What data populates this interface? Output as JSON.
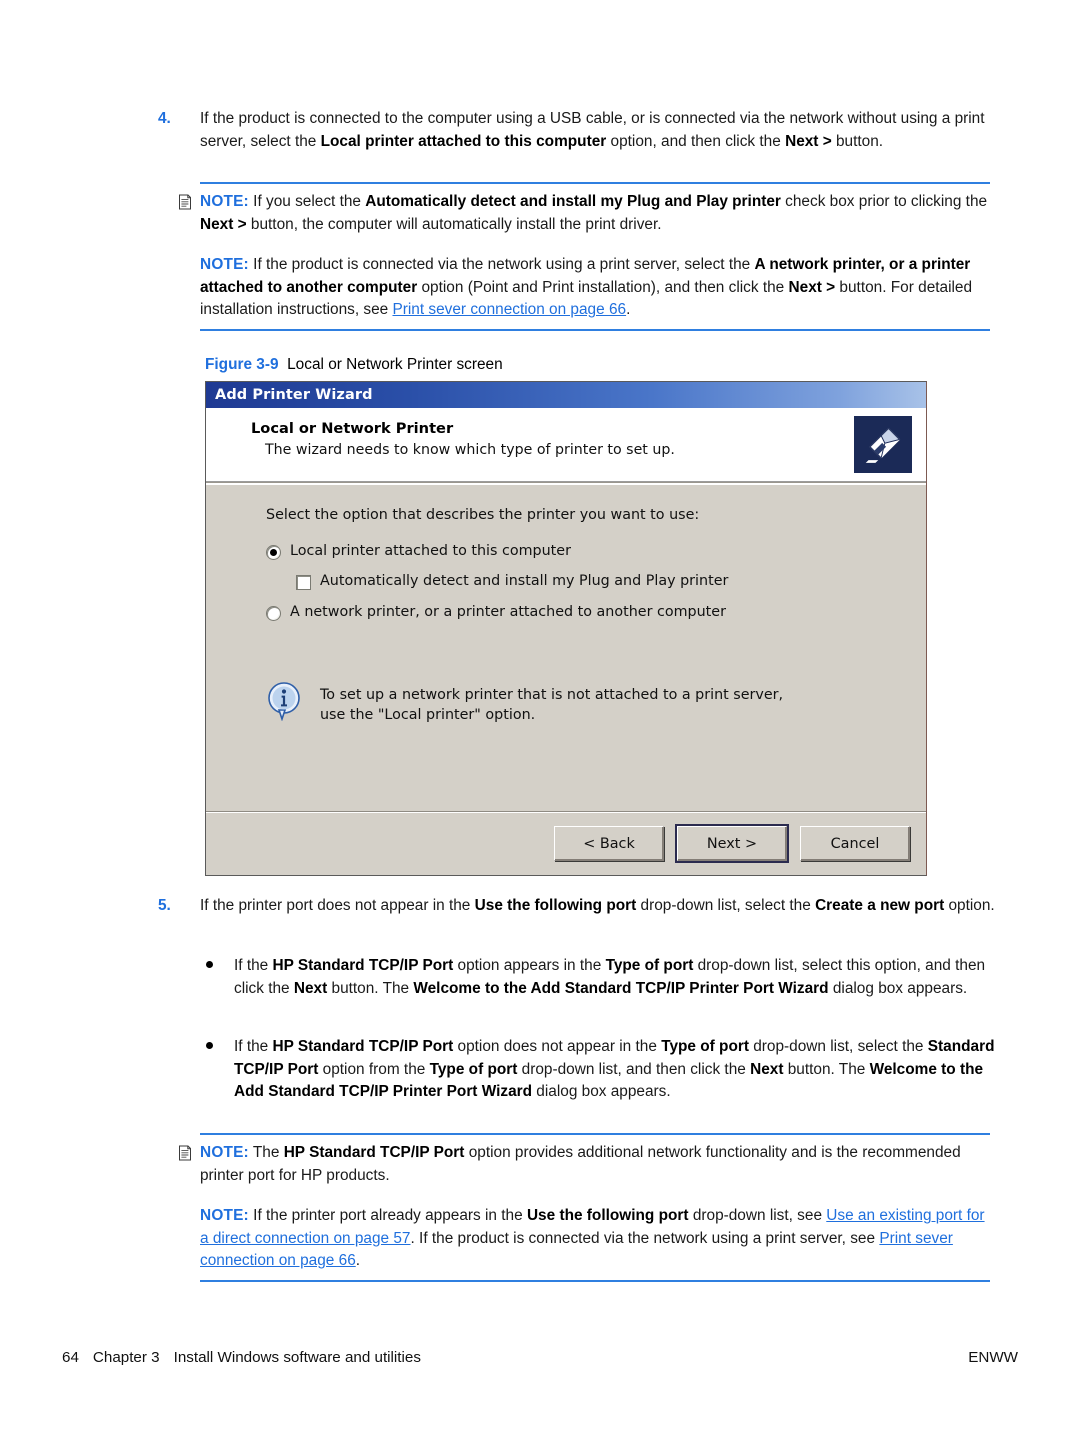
{
  "page": {
    "number": "64",
    "chapter": "Chapter 3",
    "chapter_title": "Install Windows software and utilities",
    "publisher_code": "ENWW"
  },
  "colors": {
    "accent_blue": "#1f6fdd",
    "note_rule": "#2f7fe0",
    "link": "#1f6fdd",
    "dialog_face": "#d4d0c8",
    "titlebar_start": "#1f3a93"
  },
  "step4": {
    "number": "4.",
    "t1": "If the product is connected to the computer using a USB cable, or is connected via the network without using a print server, select the ",
    "b1": "Local printer attached to this computer",
    "t2": " option, and then click the ",
    "b2": "Next >",
    "t3": " button."
  },
  "note1": {
    "label": "NOTE:",
    "t1": " If you select the ",
    "b1": "Automatically detect and install my Plug and Play printer",
    "t2": " check box prior to clicking the ",
    "b2": "Next >",
    "t3": " button, the computer will automatically install the print driver."
  },
  "note2": {
    "label": "NOTE:",
    "t1": " If the product is connected via the network using a print server, select the ",
    "b1": "A network printer, or a printer attached to another computer",
    "t2": " option (Point and Print installation), and then click the ",
    "b2": "Next >",
    "t3": " button. For detailed installation instructions, see ",
    "link": "Print sever connection on page 66",
    "t4": "."
  },
  "figure": {
    "label": "Figure 3-9",
    "caption": "Local or Network Printer screen"
  },
  "dialog": {
    "title": "Add Printer Wizard",
    "header_title": "Local or Network Printer",
    "header_sub": "The wizard needs to know which type of printer to set up.",
    "printer_icon": "printer-icon",
    "prompt": "Select the option that describes the printer you want to use:",
    "options": [
      {
        "label": "Local printer attached to this computer",
        "control": "radio",
        "checked": true
      },
      {
        "label": "Automatically detect and install my Plug and Play printer",
        "control": "checkbox",
        "checked": false
      },
      {
        "label": "A network printer, or a printer attached to another computer",
        "control": "radio",
        "checked": false
      }
    ],
    "info": {
      "icon": "info-icon",
      "line1": "To set up a network printer that is not attached to a print server,",
      "line2": "use the \"Local printer\" option."
    },
    "buttons": [
      {
        "label": "< Back",
        "default": false
      },
      {
        "label": "Next >",
        "default": true
      },
      {
        "label": "Cancel",
        "default": false
      }
    ]
  },
  "step5": {
    "number": "5.",
    "t1": "If the printer port does not appear in the ",
    "b1": "Use the following port",
    "t2": " drop-down list, select the ",
    "b2": "Create a new port",
    "t3": " option."
  },
  "bullet1": {
    "t1": "If the ",
    "b1": "HP Standard TCP/IP Port",
    "t2": " option appears in the ",
    "b2": "Type of port",
    "t3": " drop-down list, select this option, and then click the ",
    "b3": "Next",
    "t4": " button. The ",
    "b4": "Welcome to the Add Standard TCP/IP Printer Port Wizard",
    "t5": " dialog box appears."
  },
  "bullet2": {
    "t1": "If the ",
    "b1": "HP Standard TCP/IP Port",
    "t2": " option does not appear in the ",
    "b2": "Type of port",
    "t3": " drop-down list, select the ",
    "b3": "Standard TCP/IP Port",
    "t4": " option from the ",
    "b4": "Type of port",
    "t5": " drop-down list, and then click the ",
    "b5": "Next",
    "t6": " button. The ",
    "b6": "Welcome to the Add Standard TCP/IP Printer Port Wizard",
    "t7": " dialog box appears."
  },
  "note3": {
    "label": "NOTE:",
    "t1": " The ",
    "b1": "HP Standard TCP/IP Port",
    "t2": " option provides additional network functionality and is the recommended printer port for HP products."
  },
  "note4": {
    "label": "NOTE:",
    "t1": " If the printer port already appears in the ",
    "b1": "Use the following port",
    "t2": " drop-down list, see ",
    "link1": "Use an existing port for a direct connection on page 57",
    "t3": ". If the product is connected via the network using a print server, see ",
    "link2": "Print sever connection on page 66",
    "t4": "."
  }
}
